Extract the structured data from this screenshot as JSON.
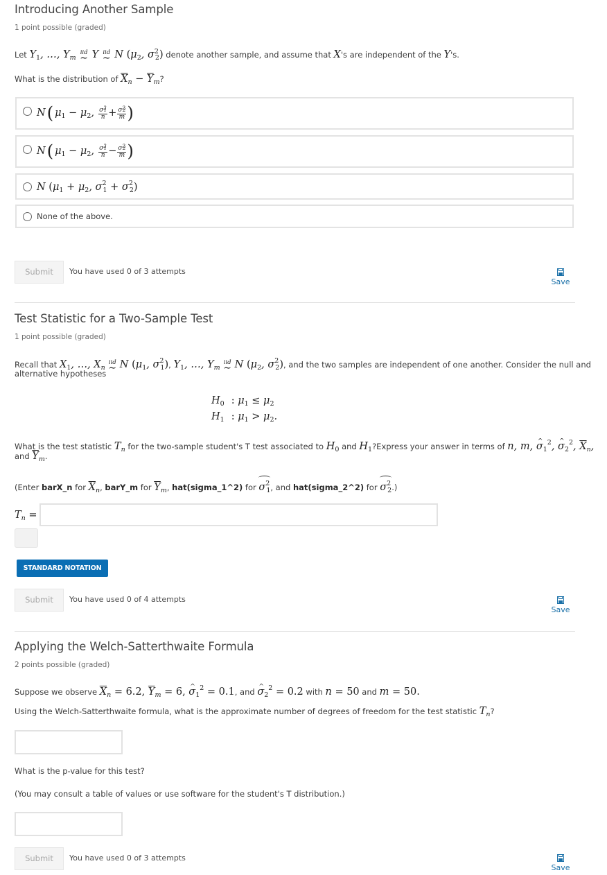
{
  "problems": [
    {
      "title": "Introducing Another Sample",
      "points": "1 point possible (graded)",
      "intro": {
        "prefix": "Let ",
        "middle": " denote another sample, and assume that ",
        "xs": "'s are independent of the ",
        "ys": "'s."
      },
      "question": {
        "prefix": "What is the distribution of ",
        "suffix": "?"
      },
      "choices": [
        {
          "label": "N(μ1 − μ2, σ1²/n + σ2²/m)",
          "selected": false
        },
        {
          "label": "N(μ1 − μ2, σ1²/n − σ2²/m)",
          "selected": false
        },
        {
          "label": "N(μ1 + μ2, σ1² + σ2²)",
          "selected": false
        },
        {
          "label": "None of the above.",
          "selected": false
        }
      ],
      "submit_label": "Submit",
      "attempts": "You have used 0 of 3 attempts",
      "save_label": "Save"
    },
    {
      "title": "Test Statistic for a Two-Sample Test",
      "points": "1 point possible (graded)",
      "recall": {
        "prefix": "Recall that ",
        "middle": ", and the two samples are independent of one another. Consider the null and",
        "line2": "alternative hypotheses"
      },
      "hypotheses": [
        {
          "name": "H0",
          "relation": ": μ1 ≤ μ2"
        },
        {
          "name": "H1",
          "relation": ": μ1 > μ2."
        }
      ],
      "question": {
        "p1": "What is the test statistic ",
        "p2": " for the two-sample student's T test associated to ",
        "p3": " and ",
        "p4": "?Express your answer in terms of ",
        "line2_prefix": "and "
      },
      "hint": {
        "open": "(Enter ",
        "k1": "barX_n",
        "for": " for ",
        "k2": "barY_m",
        "k3": "hat(sigma_1^2)",
        "and": ", and ",
        "k4": "hat(sigma_2^2)",
        "close": ".)"
      },
      "answer_label": "Tn =",
      "answer_value": "",
      "notation_button": "STANDARD NOTATION",
      "submit_label": "Submit",
      "attempts": "You have used 0 of 4 attempts",
      "save_label": "Save"
    },
    {
      "title": "Applying the Welch-Satterthwaite Formula",
      "points": "2 points possible (graded)",
      "observe": {
        "prefix": "Suppose we observe ",
        "xbar": "6.2",
        "ybar": "6",
        "s1": "0.1",
        "and": ", and ",
        "s2": "0.2",
        "with": " with ",
        "n": "50",
        "and2": " and ",
        "m": "50"
      },
      "q1": {
        "prefix": "Using the Welch-Satterthwaite formula, what is the approximate number of degrees of freedom for the test statistic ",
        "suffix": "?"
      },
      "q1_value": "",
      "q2": "What is the p-value for this test?",
      "q2_note": "(You may consult a table of values or use software for the student's T distribution.)",
      "q2_value": "",
      "submit_label": "Submit",
      "attempts": "You have used 0 of 3 attempts",
      "save_label": "Save"
    }
  ],
  "colors": {
    "accent": "#0a6eb4",
    "link": "#1a70a8",
    "border": "#e3e3e3"
  }
}
